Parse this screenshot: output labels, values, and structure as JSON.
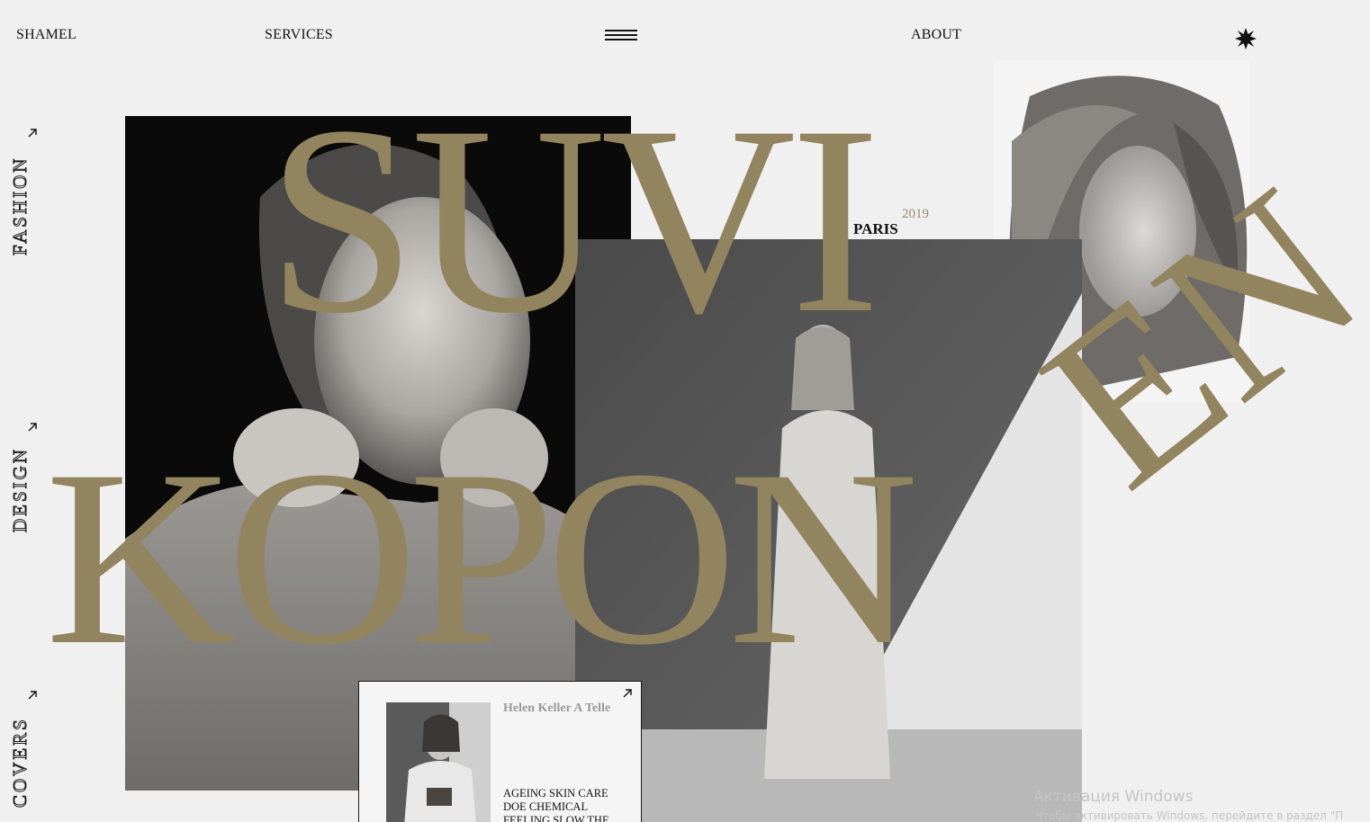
{
  "nav": {
    "brand": "SHAMEL",
    "services": "SERVICES",
    "about": "ABOUT",
    "menu_icon": "hamburger-icon",
    "star_icon": "star-icon"
  },
  "sidebar": {
    "items": [
      {
        "label": "FASHION",
        "icon": "arrow-up-right-icon"
      },
      {
        "label": "DESIGN",
        "icon": "arrow-up-right-icon"
      },
      {
        "label": "COVERS",
        "icon": "arrow-up-right-icon"
      }
    ]
  },
  "hero": {
    "first_name": "SUVI",
    "last_name": "KOPON",
    "last_name_rotated": "EN",
    "year": "2019",
    "city": "PARIS",
    "accent_color": "#938460"
  },
  "card": {
    "title": "Helen Keller A Telle",
    "text": "AGEING SKIN CARE DOE CHEMICAL FEELING SLOW THE",
    "icon": "arrow-up-right-icon"
  },
  "watermark": {
    "line1": "Активация Windows",
    "line2": "Чтобы активировать Windows, перейдите в раздел \"П"
  }
}
